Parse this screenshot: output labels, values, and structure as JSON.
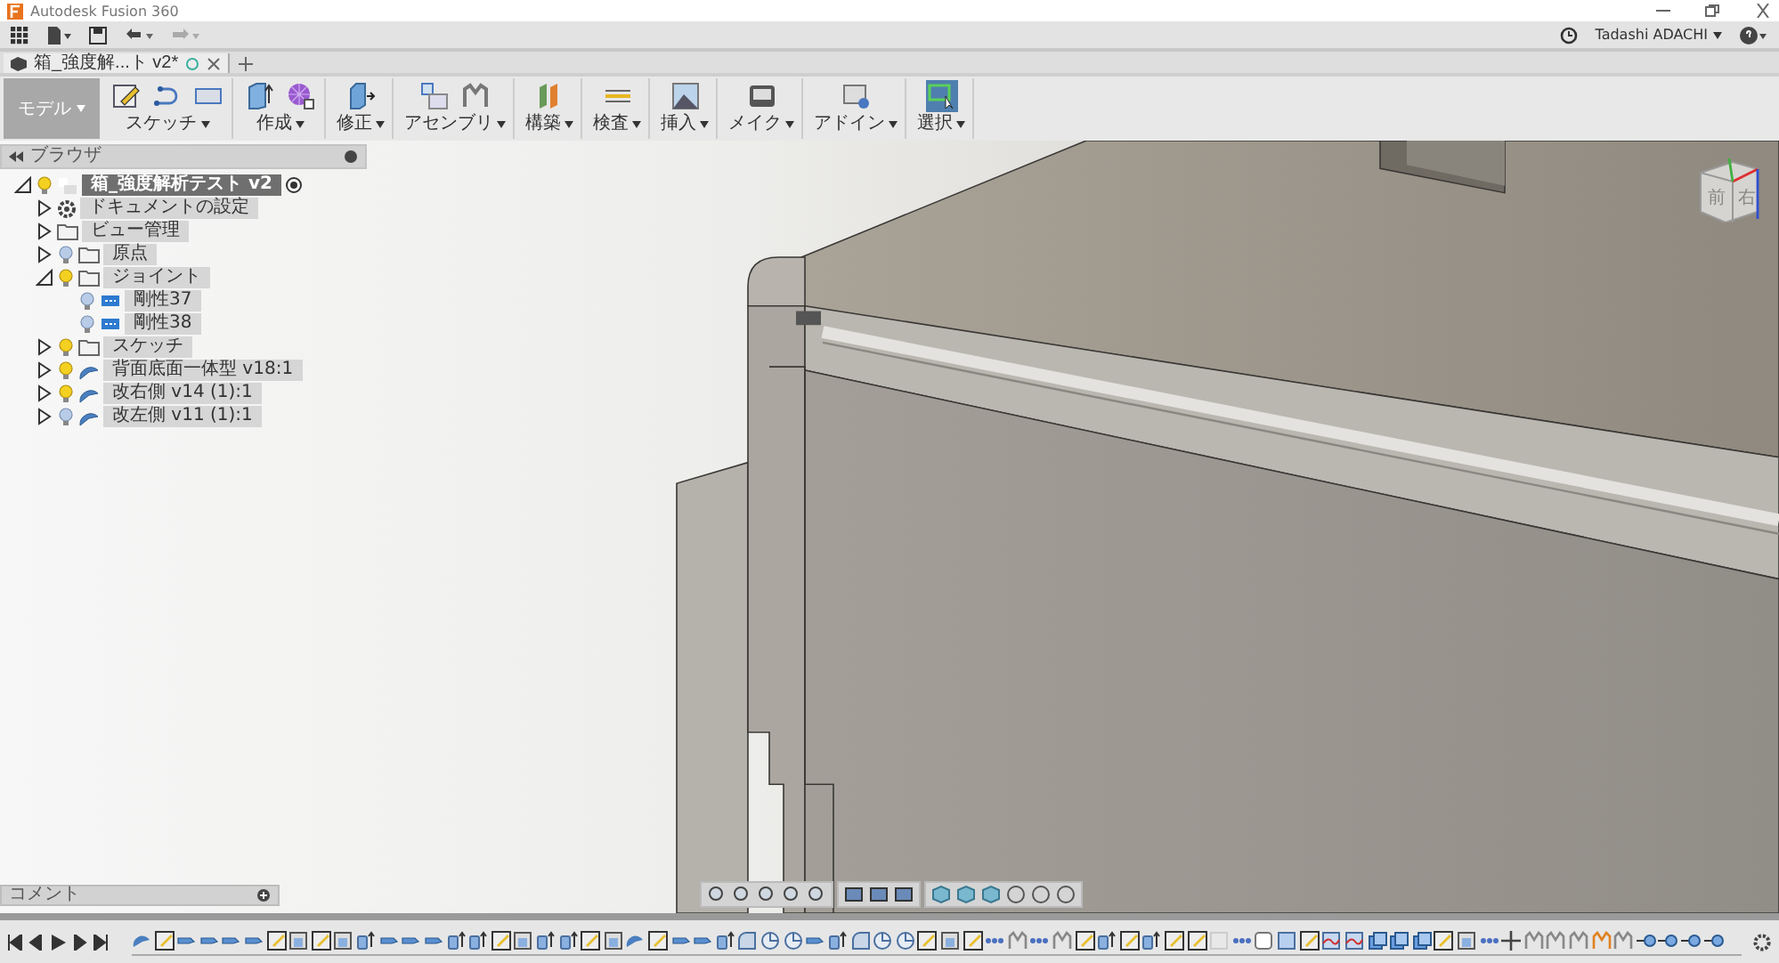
{
  "window": {
    "title": "Autodesk Fusion 360"
  },
  "account": {
    "user": "Tadashi ADACHI"
  },
  "document_tab": {
    "title": "箱_強度解...ト v2*"
  },
  "workspace": {
    "label": "モデル"
  },
  "ribbon_groups": [
    {
      "label": "スケッチ",
      "tools": [
        {
          "kind": "create-sketch"
        },
        {
          "kind": "spline"
        },
        {
          "kind": "rectangle"
        }
      ],
      "selected": false
    },
    {
      "label": "作成",
      "tools": [
        {
          "kind": "extrude"
        },
        {
          "kind": "mesh"
        }
      ],
      "selected": false
    },
    {
      "label": "修正",
      "tools": [
        {
          "kind": "press-pull"
        }
      ],
      "selected": false
    },
    {
      "label": "アセンブリ",
      "tools": [
        {
          "kind": "new-component"
        },
        {
          "kind": "joint"
        }
      ],
      "selected": false
    },
    {
      "label": "構築",
      "tools": [
        {
          "kind": "plane"
        }
      ],
      "selected": false
    },
    {
      "label": "検査",
      "tools": [
        {
          "kind": "measure"
        }
      ],
      "selected": false
    },
    {
      "label": "挿入",
      "tools": [
        {
          "kind": "image"
        }
      ],
      "selected": false
    },
    {
      "label": "メイク",
      "tools": [
        {
          "kind": "printer"
        }
      ],
      "selected": false
    },
    {
      "label": "アドイン",
      "tools": [
        {
          "kind": "scripts"
        }
      ],
      "selected": false
    },
    {
      "label": "選択",
      "tools": [
        {
          "kind": "select"
        }
      ],
      "selected": true
    }
  ],
  "browser": {
    "title": "ブラウザ",
    "tree": [
      {
        "label": "箱_強度解析テスト v2",
        "kind": "document",
        "selected": true,
        "visible": true,
        "expanded": true,
        "children": [
          {
            "label": "ドキュメントの設定",
            "kind": "settings",
            "selected": false,
            "expanded": false
          },
          {
            "label": "ビュー管理",
            "kind": "folder",
            "selected": false,
            "expanded": false
          },
          {
            "label": "原点",
            "kind": "folder",
            "selected": false,
            "visible": false,
            "expanded": false
          },
          {
            "label": "ジョイント",
            "kind": "folder",
            "selected": false,
            "visible": true,
            "expanded": true,
            "children": [
              {
                "label": "剛性37",
                "kind": "joint",
                "selected": false,
                "visible": false
              },
              {
                "label": "剛性38",
                "kind": "joint",
                "selected": false,
                "visible": false
              }
            ]
          },
          {
            "label": "スケッチ",
            "kind": "folder",
            "selected": false,
            "visible": true,
            "expanded": false
          },
          {
            "label": "背面底面一体型 v18:1",
            "kind": "component",
            "selected": false,
            "visible": true,
            "expanded": false
          },
          {
            "label": "改右側 v14 (1):1",
            "kind": "component",
            "selected": false,
            "visible": true,
            "expanded": false
          },
          {
            "label": "改左側 v11 (1):1",
            "kind": "component",
            "selected": false,
            "visible": false,
            "expanded": false
          }
        ]
      }
    ]
  },
  "view_cube": {
    "faces": [
      "前",
      "右"
    ]
  },
  "comments": {
    "title": "コメント"
  },
  "timeline": {
    "features": [
      {
        "kind": "component"
      },
      {
        "kind": "sketch"
      },
      {
        "kind": "pull"
      },
      {
        "kind": "pull"
      },
      {
        "kind": "pull"
      },
      {
        "kind": "pull"
      },
      {
        "kind": "sketch"
      },
      {
        "kind": "combine"
      },
      {
        "kind": "sketch"
      },
      {
        "kind": "combine"
      },
      {
        "kind": "extrude"
      },
      {
        "kind": "pull"
      },
      {
        "kind": "pull"
      },
      {
        "kind": "pull"
      },
      {
        "kind": "extrude"
      },
      {
        "kind": "extrude"
      },
      {
        "kind": "sketch"
      },
      {
        "kind": "combine"
      },
      {
        "kind": "extrude"
      },
      {
        "kind": "extrude"
      },
      {
        "kind": "sketch"
      },
      {
        "kind": "combine"
      },
      {
        "kind": "component"
      },
      {
        "kind": "sketch"
      },
      {
        "kind": "pull"
      },
      {
        "kind": "pull"
      },
      {
        "kind": "extrude"
      },
      {
        "kind": "fillet"
      },
      {
        "kind": "shell"
      },
      {
        "kind": "shell"
      },
      {
        "kind": "pull"
      },
      {
        "kind": "extrude"
      },
      {
        "kind": "fillet"
      },
      {
        "kind": "shell"
      },
      {
        "kind": "shell"
      },
      {
        "kind": "sketch"
      },
      {
        "kind": "combine"
      },
      {
        "kind": "sketch"
      },
      {
        "kind": "joint"
      },
      {
        "kind": "rigid"
      },
      {
        "kind": "joint"
      },
      {
        "kind": "rigid"
      },
      {
        "kind": "sketch"
      },
      {
        "kind": "extrude"
      },
      {
        "kind": "sketch"
      },
      {
        "kind": "extrude"
      },
      {
        "kind": "sketch"
      },
      {
        "kind": "sketch"
      },
      {
        "kind": "ghost"
      },
      {
        "kind": "joint"
      },
      {
        "kind": "box"
      },
      {
        "kind": "plane"
      },
      {
        "kind": "sketch"
      },
      {
        "kind": "surface"
      },
      {
        "kind": "surface"
      },
      {
        "kind": "copy"
      },
      {
        "kind": "copy"
      },
      {
        "kind": "copy"
      },
      {
        "kind": "sketch"
      },
      {
        "kind": "combine"
      },
      {
        "kind": "joint"
      },
      {
        "kind": "move"
      },
      {
        "kind": "rigid"
      },
      {
        "kind": "rigid"
      },
      {
        "kind": "rigid"
      },
      {
        "kind": "warning"
      },
      {
        "kind": "rigid"
      },
      {
        "kind": "pin"
      },
      {
        "kind": "pin"
      },
      {
        "kind": "pin"
      },
      {
        "kind": "pin"
      }
    ]
  }
}
